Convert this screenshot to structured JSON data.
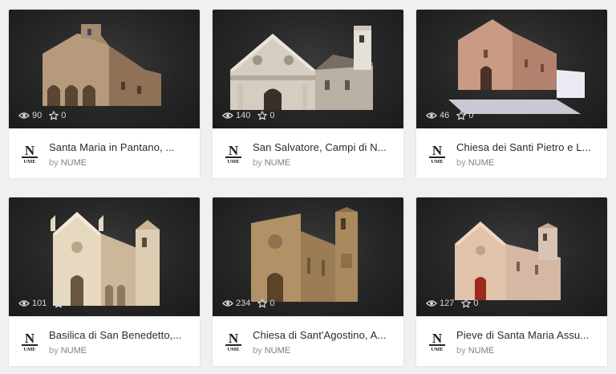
{
  "cards": [
    {
      "title": "Santa Maria in Pantano, ...",
      "views": "90",
      "likes": "0",
      "by": "by",
      "author": "NUME"
    },
    {
      "title": "San Salvatore, Campi di N...",
      "views": "140",
      "likes": "0",
      "by": "by",
      "author": "NUME"
    },
    {
      "title": "Chiesa dei Santi Pietro e L...",
      "views": "46",
      "likes": "0",
      "by": "by",
      "author": "NUME"
    },
    {
      "title": "Basilica di San Benedetto,...",
      "views": "101",
      "likes": "0",
      "by": "by",
      "author": "NUME"
    },
    {
      "title": "Chiesa di Sant'Agostino, A...",
      "views": "234",
      "likes": "0",
      "by": "by",
      "author": "NUME"
    },
    {
      "title": "Pieve di Santa Maria Assu...",
      "views": "127",
      "likes": "0",
      "by": "by",
      "author": "NUME"
    }
  ],
  "icons": {
    "views": "eye-icon",
    "likes": "star-icon",
    "logo": "nume-logo"
  }
}
